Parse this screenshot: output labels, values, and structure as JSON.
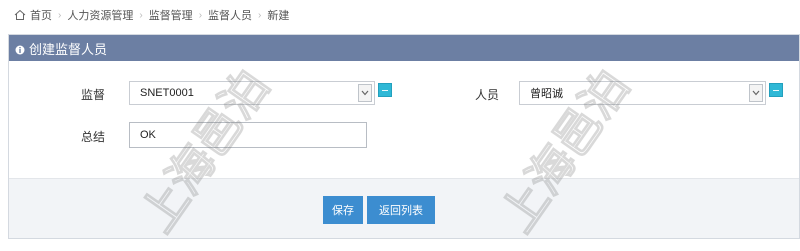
{
  "breadcrumb": {
    "items": [
      "首页",
      "人力资源管理",
      "监督管理",
      "监督人员",
      "新建"
    ]
  },
  "panel": {
    "title": "创建监督人员"
  },
  "form": {
    "supervision_label": "监督",
    "supervision_value": "SNET0001",
    "person_label": "人员",
    "person_value": "曾昭诚",
    "summary_label": "总结",
    "summary_value": "OK"
  },
  "actions": {
    "save_label": "保存",
    "back_label": "返回列表"
  },
  "watermark": {
    "text": "上海邑泊"
  },
  "colors": {
    "header_bg": "#6c7fa3",
    "button_bg": "#3c8dd0",
    "pick_button": "#2fb8d6"
  }
}
